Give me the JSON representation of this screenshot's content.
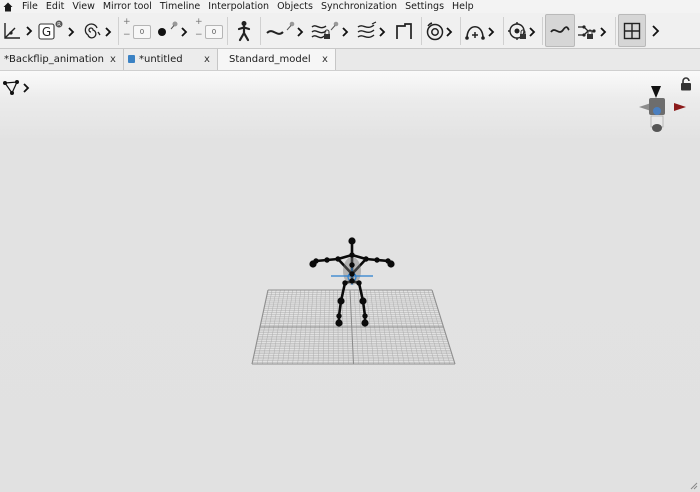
{
  "menu": {
    "items": [
      "File",
      "Edit",
      "View",
      "Mirror tool",
      "Timeline",
      "Interpolation",
      "Objects",
      "Synchronization",
      "Settings",
      "Help"
    ]
  },
  "toolbar": {
    "global_badge": "G",
    "global_superscript": "R",
    "offset_value_1": "0",
    "offset_value_2": "0"
  },
  "tabs": [
    {
      "label": "*Backflip_animation",
      "close": "x",
      "active": false,
      "icon": "none"
    },
    {
      "label": "*untitled",
      "close": "x",
      "active": false,
      "icon": "document-icon"
    },
    {
      "label": "Standard_model",
      "close": "x",
      "active": true,
      "icon": "none"
    }
  ],
  "colors": {
    "menubar_bg": "#f3f3f3",
    "toolbar_bg": "#f0f0f0",
    "viewport_bg": "#e1e1e1",
    "skeleton": "#0a0a0a",
    "grid": "#9a9a9a",
    "gizmo_red": "#8b1a1a",
    "gizmo_blue": "#4a7fc0",
    "selection_blue": "#2a7fcf"
  }
}
